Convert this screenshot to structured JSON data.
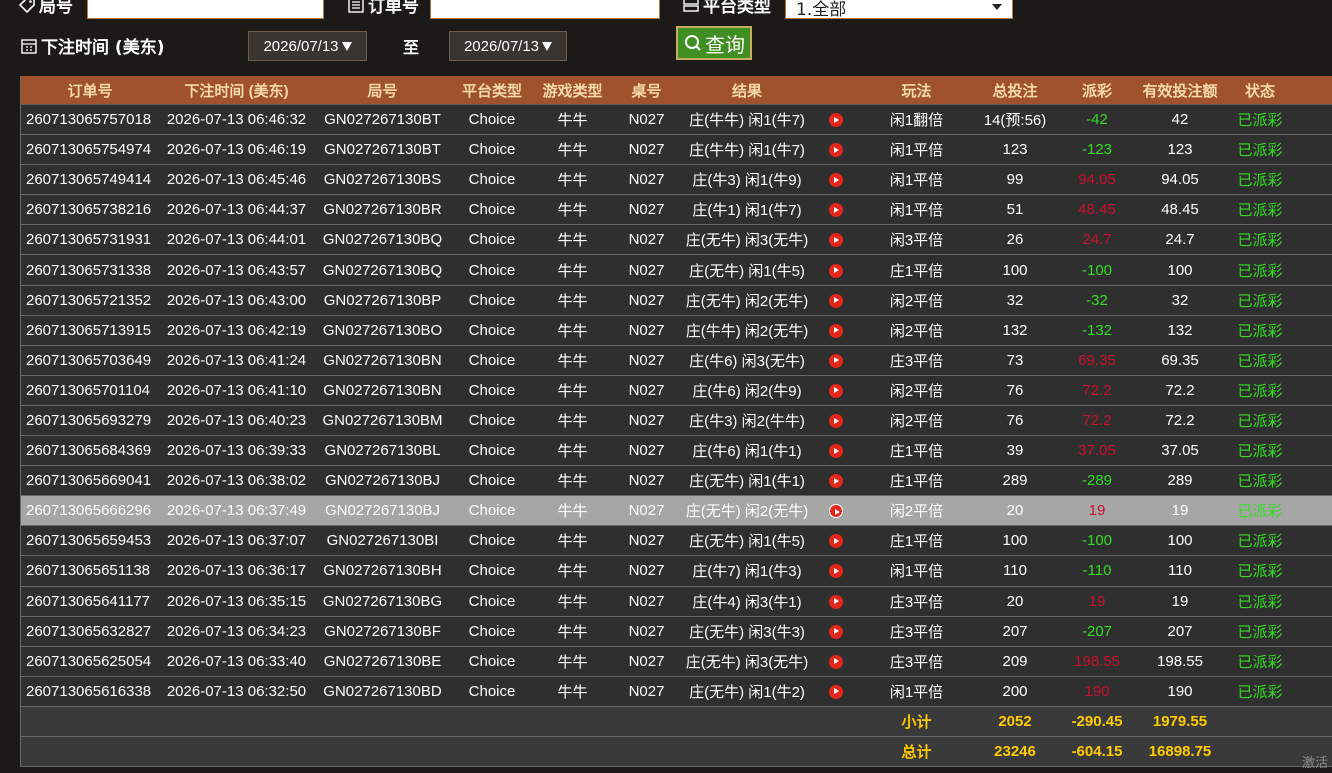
{
  "filters": {
    "round_label": "局号",
    "round_value": "",
    "order_label": "订单号",
    "order_value": "",
    "platform_label": "平台类型",
    "platform_selected": "1.全部",
    "time_label": "下注时间 (美东)",
    "date_from": "2026/07/13",
    "to_label": "至",
    "date_to": "2026/07/13",
    "query_label": "查询"
  },
  "table": {
    "headers": [
      "订单号",
      "下注时间 (美东)",
      "局号",
      "平台类型",
      "游戏类型",
      "桌号",
      "结果",
      "",
      "玩法",
      "总投注",
      "派彩",
      "有效投注额",
      "状态"
    ],
    "rows": [
      {
        "order": "260713065757018",
        "time": "2026-07-13 06:46:32",
        "round": "GN027267130BT",
        "platform": "Choice",
        "game": "牛牛",
        "table": "N027",
        "result": "庄(牛牛) 闲1(牛7)",
        "play": "闲1翻倍",
        "bet": "14(预:56)",
        "payout": "-42",
        "payout_color": "#33dd22",
        "valid": "42",
        "status": "已派彩"
      },
      {
        "order": "260713065754974",
        "time": "2026-07-13 06:46:19",
        "round": "GN027267130BT",
        "platform": "Choice",
        "game": "牛牛",
        "table": "N027",
        "result": "庄(牛牛) 闲1(牛7)",
        "play": "闲1平倍",
        "bet": "123",
        "payout": "-123",
        "payout_color": "#33dd22",
        "valid": "123",
        "status": "已派彩"
      },
      {
        "order": "260713065749414",
        "time": "2026-07-13 06:45:46",
        "round": "GN027267130BS",
        "platform": "Choice",
        "game": "牛牛",
        "table": "N027",
        "result": "庄(牛3) 闲1(牛9)",
        "play": "闲1平倍",
        "bet": "99",
        "payout": "94.05",
        "payout_color": "#c8102e",
        "valid": "94.05",
        "status": "已派彩"
      },
      {
        "order": "260713065738216",
        "time": "2026-07-13 06:44:37",
        "round": "GN027267130BR",
        "platform": "Choice",
        "game": "牛牛",
        "table": "N027",
        "result": "庄(牛1) 闲1(牛7)",
        "play": "闲1平倍",
        "bet": "51",
        "payout": "48.45",
        "payout_color": "#c8102e",
        "valid": "48.45",
        "status": "已派彩"
      },
      {
        "order": "260713065731931",
        "time": "2026-07-13 06:44:01",
        "round": "GN027267130BQ",
        "platform": "Choice",
        "game": "牛牛",
        "table": "N027",
        "result": "庄(无牛) 闲3(无牛)",
        "play": "闲3平倍",
        "bet": "26",
        "payout": "24.7",
        "payout_color": "#c8102e",
        "valid": "24.7",
        "status": "已派彩"
      },
      {
        "order": "260713065731338",
        "time": "2026-07-13 06:43:57",
        "round": "GN027267130BQ",
        "platform": "Choice",
        "game": "牛牛",
        "table": "N027",
        "result": "庄(无牛) 闲1(牛5)",
        "play": "庄1平倍",
        "bet": "100",
        "payout": "-100",
        "payout_color": "#33dd22",
        "valid": "100",
        "status": "已派彩"
      },
      {
        "order": "260713065721352",
        "time": "2026-07-13 06:43:00",
        "round": "GN027267130BP",
        "platform": "Choice",
        "game": "牛牛",
        "table": "N027",
        "result": "庄(无牛) 闲2(无牛)",
        "play": "闲2平倍",
        "bet": "32",
        "payout": "-32",
        "payout_color": "#33dd22",
        "valid": "32",
        "status": "已派彩"
      },
      {
        "order": "260713065713915",
        "time": "2026-07-13 06:42:19",
        "round": "GN027267130BO",
        "platform": "Choice",
        "game": "牛牛",
        "table": "N027",
        "result": "庄(牛牛) 闲2(无牛)",
        "play": "闲2平倍",
        "bet": "132",
        "payout": "-132",
        "payout_color": "#33dd22",
        "valid": "132",
        "status": "已派彩"
      },
      {
        "order": "260713065703649",
        "time": "2026-07-13 06:41:24",
        "round": "GN027267130BN",
        "platform": "Choice",
        "game": "牛牛",
        "table": "N027",
        "result": "庄(牛6) 闲3(无牛)",
        "play": "庄3平倍",
        "bet": "73",
        "payout": "69.35",
        "payout_color": "#c8102e",
        "valid": "69.35",
        "status": "已派彩"
      },
      {
        "order": "260713065701104",
        "time": "2026-07-13 06:41:10",
        "round": "GN027267130BN",
        "platform": "Choice",
        "game": "牛牛",
        "table": "N027",
        "result": "庄(牛6) 闲2(牛9)",
        "play": "闲2平倍",
        "bet": "76",
        "payout": "72.2",
        "payout_color": "#c8102e",
        "valid": "72.2",
        "status": "已派彩"
      },
      {
        "order": "260713065693279",
        "time": "2026-07-13 06:40:23",
        "round": "GN027267130BM",
        "platform": "Choice",
        "game": "牛牛",
        "table": "N027",
        "result": "庄(牛3) 闲2(牛牛)",
        "play": "闲2平倍",
        "bet": "76",
        "payout": "72.2",
        "payout_color": "#c8102e",
        "valid": "72.2",
        "status": "已派彩"
      },
      {
        "order": "260713065684369",
        "time": "2026-07-13 06:39:33",
        "round": "GN027267130BL",
        "platform": "Choice",
        "game": "牛牛",
        "table": "N027",
        "result": "庄(牛6) 闲1(牛1)",
        "play": "庄1平倍",
        "bet": "39",
        "payout": "37.05",
        "payout_color": "#c8102e",
        "valid": "37.05",
        "status": "已派彩"
      },
      {
        "order": "260713065669041",
        "time": "2026-07-13 06:38:02",
        "round": "GN027267130BJ",
        "platform": "Choice",
        "game": "牛牛",
        "table": "N027",
        "result": "庄(无牛) 闲1(牛1)",
        "play": "庄1平倍",
        "bet": "289",
        "payout": "-289",
        "payout_color": "#33dd22",
        "valid": "289",
        "status": "已派彩"
      },
      {
        "order": "260713065666296",
        "time": "2026-07-13 06:37:49",
        "round": "GN027267130BJ",
        "platform": "Choice",
        "game": "牛牛",
        "table": "N027",
        "result": "庄(无牛) 闲2(无牛)",
        "play": "闲2平倍",
        "bet": "20",
        "payout": "19",
        "payout_color": "#c8102e",
        "valid": "19",
        "status": "已派彩",
        "selected": true
      },
      {
        "order": "260713065659453",
        "time": "2026-07-13 06:37:07",
        "round": "GN027267130BI",
        "platform": "Choice",
        "game": "牛牛",
        "table": "N027",
        "result": "庄(无牛) 闲1(牛5)",
        "play": "庄1平倍",
        "bet": "100",
        "payout": "-100",
        "payout_color": "#33dd22",
        "valid": "100",
        "status": "已派彩"
      },
      {
        "order": "260713065651138",
        "time": "2026-07-13 06:36:17",
        "round": "GN027267130BH",
        "platform": "Choice",
        "game": "牛牛",
        "table": "N027",
        "result": "庄(牛7) 闲1(牛3)",
        "play": "闲1平倍",
        "bet": "110",
        "payout": "-110",
        "payout_color": "#33dd22",
        "valid": "110",
        "status": "已派彩"
      },
      {
        "order": "260713065641177",
        "time": "2026-07-13 06:35:15",
        "round": "GN027267130BG",
        "platform": "Choice",
        "game": "牛牛",
        "table": "N027",
        "result": "庄(牛4) 闲3(牛1)",
        "play": "庄3平倍",
        "bet": "20",
        "payout": "19",
        "payout_color": "#c8102e",
        "valid": "19",
        "status": "已派彩"
      },
      {
        "order": "260713065632827",
        "time": "2026-07-13 06:34:23",
        "round": "GN027267130BF",
        "platform": "Choice",
        "game": "牛牛",
        "table": "N027",
        "result": "庄(无牛) 闲3(牛3)",
        "play": "庄3平倍",
        "bet": "207",
        "payout": "-207",
        "payout_color": "#33dd22",
        "valid": "207",
        "status": "已派彩"
      },
      {
        "order": "260713065625054",
        "time": "2026-07-13 06:33:40",
        "round": "GN027267130BE",
        "platform": "Choice",
        "game": "牛牛",
        "table": "N027",
        "result": "庄(无牛) 闲3(无牛)",
        "play": "庄3平倍",
        "bet": "209",
        "payout": "198.55",
        "payout_color": "#c8102e",
        "valid": "198.55",
        "status": "已派彩"
      },
      {
        "order": "260713065616338",
        "time": "2026-07-13 06:32:50",
        "round": "GN027267130BD",
        "platform": "Choice",
        "game": "牛牛",
        "table": "N027",
        "result": "庄(无牛) 闲1(牛2)",
        "play": "闲1平倍",
        "bet": "200",
        "payout": "190",
        "payout_color": "#c8102e",
        "valid": "190",
        "status": "已派彩"
      }
    ],
    "subtotal": {
      "label": "小计",
      "bet": "2052",
      "payout": "-290.45",
      "valid": "1979.55"
    },
    "total": {
      "label": "总计",
      "bet": "23246",
      "payout": "-604.15",
      "valid": "16898.75"
    }
  },
  "colors": {
    "status": "#33dd22",
    "header_bg": "#a0522d",
    "accent_border": "#b87a3c"
  },
  "watermark": "激活"
}
